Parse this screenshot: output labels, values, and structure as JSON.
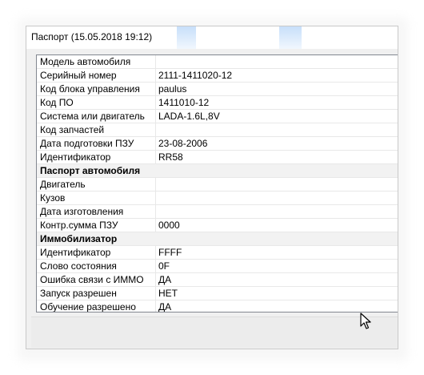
{
  "window": {
    "title": "Паспорт (15.05.2018  19:12)"
  },
  "grid": {
    "rows": [
      {
        "label": "Модель автомобиля",
        "value": ""
      },
      {
        "label": "Серийный номер",
        "value": "2111-1411020-12"
      },
      {
        "label": "Код блока управления",
        "value": "paulus"
      },
      {
        "label": "Код ПО",
        "value": "1411010-12"
      },
      {
        "label": "Система или двигатель",
        "value": "LADA-1.6L,8V"
      },
      {
        "label": "Код запчастей",
        "value": ""
      },
      {
        "label": "Дата подготовки ПЗУ",
        "value": "23-08-2006"
      },
      {
        "label": "Идентификатор",
        "value": "RR58"
      },
      {
        "label": "Паспорт автомобиля",
        "section": true
      },
      {
        "label": "Двигатель",
        "value": ""
      },
      {
        "label": "Кузов",
        "value": ""
      },
      {
        "label": "Дата изготовления",
        "value": ""
      },
      {
        "label": "Контр.сумма ПЗУ",
        "value": "0000"
      },
      {
        "label": "Иммобилизатор",
        "section": true
      },
      {
        "label": "Идентификатор",
        "value": "FFFF"
      },
      {
        "label": "Слово состояния",
        "value": "0F"
      },
      {
        "label": "Ошибка связи с ИММО",
        "value": "ДА"
      },
      {
        "label": "Запуск разрешен",
        "value": "НЕТ"
      },
      {
        "label": "Обучение разрешено",
        "value": "ДА"
      }
    ]
  },
  "colors": {
    "section_background": "#f2f2f2",
    "grid_line": "#e8e8e8",
    "window_background": "#f0f0f0",
    "title_glow": "#b4d4f8"
  },
  "cursor_icon": "arrow-cursor-icon"
}
